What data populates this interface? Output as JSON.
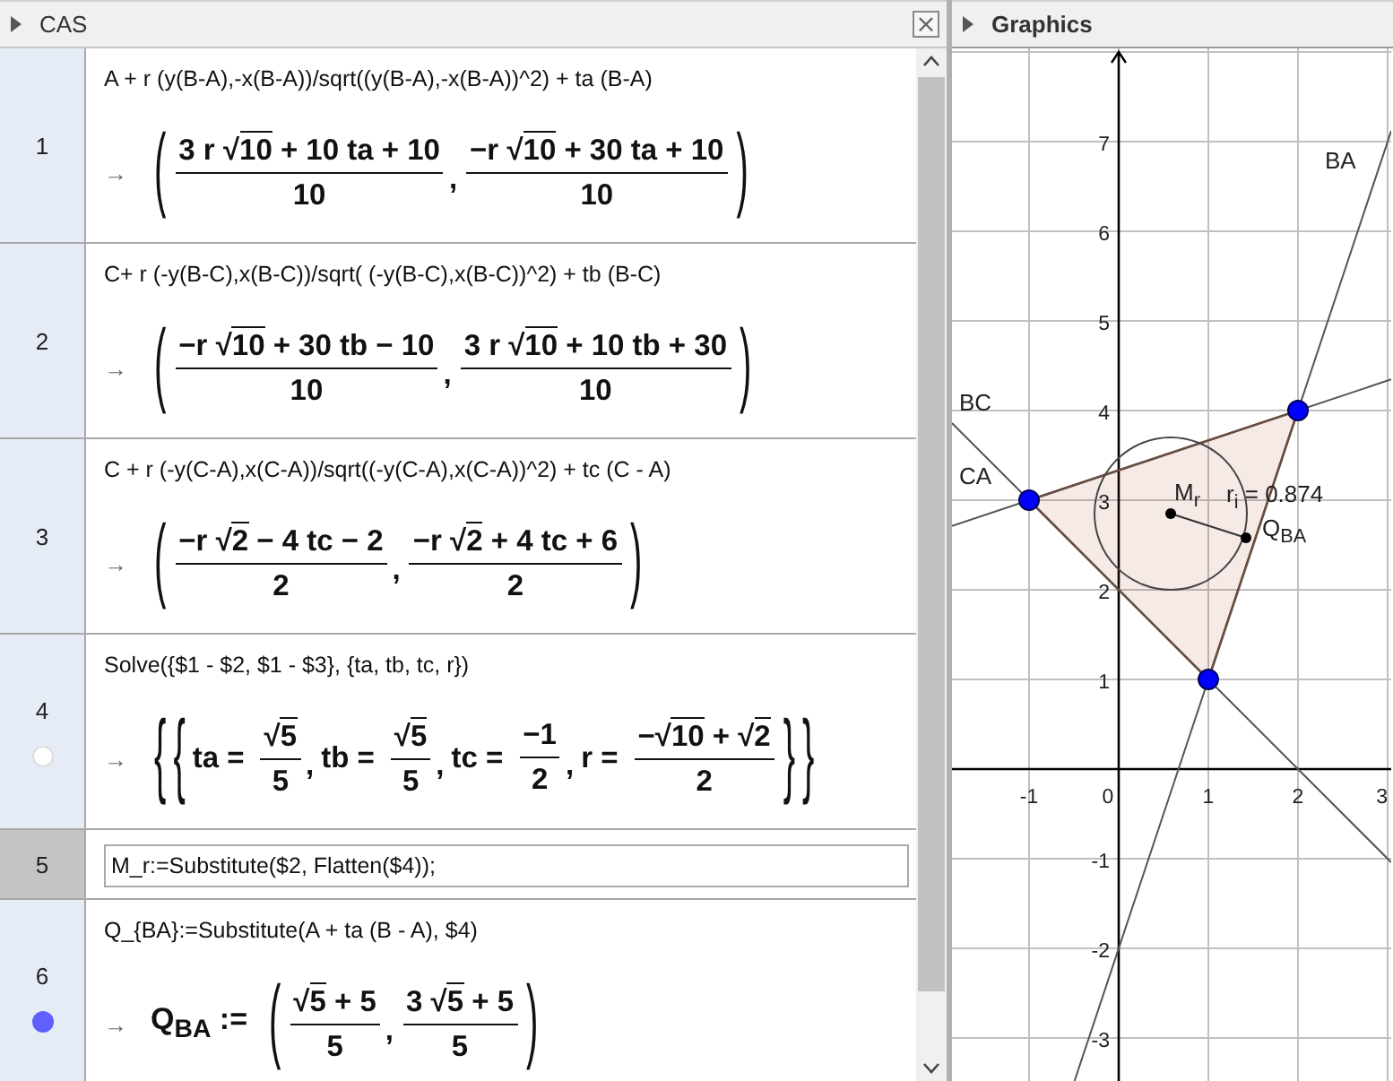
{
  "cas": {
    "title": "CAS",
    "close": "×",
    "rows": [
      {
        "number": "1",
        "selected": false,
        "input": "A + r (y(B-A),-x(B-A))/sqrt((y(B-A),-x(B-A))^2) + ta (B-A)",
        "arrow": "→",
        "output": {
          "open": [
            "("
          ],
          "close": [
            ")"
          ],
          "separator": ",",
          "items": [
            {
              "num": [
                {
                  "kind": "text",
                  "text": "3 r "
                },
                {
                  "kind": "sqrt",
                  "sign": "√",
                  "text": "10"
                },
                {
                  "kind": "text",
                  "text": " + 10 ta + 10"
                }
              ],
              "den": [
                {
                  "kind": "text",
                  "text": "10"
                }
              ]
            },
            {
              "num": [
                {
                  "kind": "text",
                  "text": "−r "
                },
                {
                  "kind": "sqrt",
                  "sign": "√",
                  "text": "10"
                },
                {
                  "kind": "text",
                  "text": " + 30 ta + 10"
                }
              ],
              "den": [
                {
                  "kind": "text",
                  "text": "10"
                }
              ]
            }
          ]
        }
      },
      {
        "number": "2",
        "selected": false,
        "input": "C+ r (-y(B-C),x(B-C))/sqrt( (-y(B-C),x(B-C))^2) + tb (B-C)",
        "arrow": "→",
        "output": {
          "open": [
            "("
          ],
          "close": [
            ")"
          ],
          "separator": ",",
          "items": [
            {
              "num": [
                {
                  "kind": "text",
                  "text": "−r "
                },
                {
                  "kind": "sqrt",
                  "sign": "√",
                  "text": "10"
                },
                {
                  "kind": "text",
                  "text": " + 30 tb − 10"
                }
              ],
              "den": [
                {
                  "kind": "text",
                  "text": "10"
                }
              ]
            },
            {
              "num": [
                {
                  "kind": "text",
                  "text": "3 r "
                },
                {
                  "kind": "sqrt",
                  "sign": "√",
                  "text": "10"
                },
                {
                  "kind": "text",
                  "text": " + 10 tb + 30"
                }
              ],
              "den": [
                {
                  "kind": "text",
                  "text": "10"
                }
              ]
            }
          ]
        }
      },
      {
        "number": "3",
        "selected": false,
        "input": "C + r (-y(C-A),x(C-A))/sqrt((-y(C-A),x(C-A))^2) + tc (C - A)",
        "arrow": "→",
        "output": {
          "open": [
            "("
          ],
          "close": [
            ")"
          ],
          "separator": ",",
          "items": [
            {
              "num": [
                {
                  "kind": "text",
                  "text": "−r "
                },
                {
                  "kind": "sqrt",
                  "sign": "√",
                  "text": "2"
                },
                {
                  "kind": "text",
                  "text": " − 4 tc − 2"
                }
              ],
              "den": [
                {
                  "kind": "text",
                  "text": "2"
                }
              ]
            },
            {
              "num": [
                {
                  "kind": "text",
                  "text": "−r "
                },
                {
                  "kind": "sqrt",
                  "sign": "√",
                  "text": "2"
                },
                {
                  "kind": "text",
                  "text": " + 4 tc + 6"
                }
              ],
              "den": [
                {
                  "kind": "text",
                  "text": "2"
                }
              ]
            }
          ]
        }
      },
      {
        "number": "4",
        "selected": false,
        "visible_in_graphics": false,
        "input": "Solve({$1 - $2, $1 - $3}, {ta, tb, tc, r})",
        "arrow": "→",
        "output": {
          "open": [
            "{",
            "{"
          ],
          "close": [
            "}",
            "}"
          ],
          "separator": ",",
          "items": [
            {
              "lhs": "ta =",
              "num": [
                {
                  "kind": "sqrt",
                  "sign": "√",
                  "text": "5"
                }
              ],
              "den": [
                {
                  "kind": "text",
                  "text": "5"
                }
              ]
            },
            {
              "lhs": "tb =",
              "num": [
                {
                  "kind": "sqrt",
                  "sign": "√",
                  "text": "5"
                }
              ],
              "den": [
                {
                  "kind": "text",
                  "text": "5"
                }
              ]
            },
            {
              "lhs": "tc =",
              "num": [
                {
                  "kind": "text",
                  "text": "−1"
                }
              ],
              "den": [
                {
                  "kind": "text",
                  "text": "2"
                }
              ]
            },
            {
              "lhs": "r =",
              "num": [
                {
                  "kind": "text",
                  "text": "−"
                },
                {
                  "kind": "sqrt",
                  "sign": "√",
                  "text": "10"
                },
                {
                  "kind": "text",
                  "text": " + "
                },
                {
                  "kind": "sqrt",
                  "sign": "√",
                  "text": "2"
                }
              ],
              "den": [
                {
                  "kind": "text",
                  "text": "2"
                }
              ]
            }
          ]
        }
      },
      {
        "number": "5",
        "selected": true,
        "input": "M_r:=Substitute($2, Flatten($4));"
      },
      {
        "number": "6",
        "selected": false,
        "visible_in_graphics": true,
        "input": "Q_{BA}:=Substitute(A + ta (B - A), $4)",
        "arrow": "→",
        "output": {
          "prefix": "Q$_{BA}$ :=",
          "open": [
            "("
          ],
          "close": [
            ")"
          ],
          "separator": ",",
          "items": [
            {
              "num": [
                {
                  "kind": "sqrt",
                  "sign": "√",
                  "text": "5"
                },
                {
                  "kind": "text",
                  "text": " + 5"
                }
              ],
              "den": [
                {
                  "kind": "text",
                  "text": "5"
                }
              ]
            },
            {
              "num": [
                {
                  "kind": "text",
                  "text": "3 "
                },
                {
                  "kind": "sqrt",
                  "sign": "√",
                  "text": "5"
                },
                {
                  "kind": "text",
                  "text": " + 5"
                }
              ],
              "den": [
                {
                  "kind": "text",
                  "text": "5"
                }
              ]
            }
          ]
        }
      }
    ]
  },
  "graphics": {
    "title": "Graphics",
    "x_tick_labels": [
      "-1",
      "0",
      "1",
      "2",
      "3"
    ],
    "y_tick_labels": [
      "7",
      "6",
      "5",
      "4",
      "3",
      "2",
      "1",
      "-1",
      "-2",
      "-3"
    ],
    "labels": [
      "BA",
      "BC",
      "CA",
      "M$_{r}$",
      "r$_{i}$ = 0.874",
      "Q$_{BA}$"
    ]
  }
}
